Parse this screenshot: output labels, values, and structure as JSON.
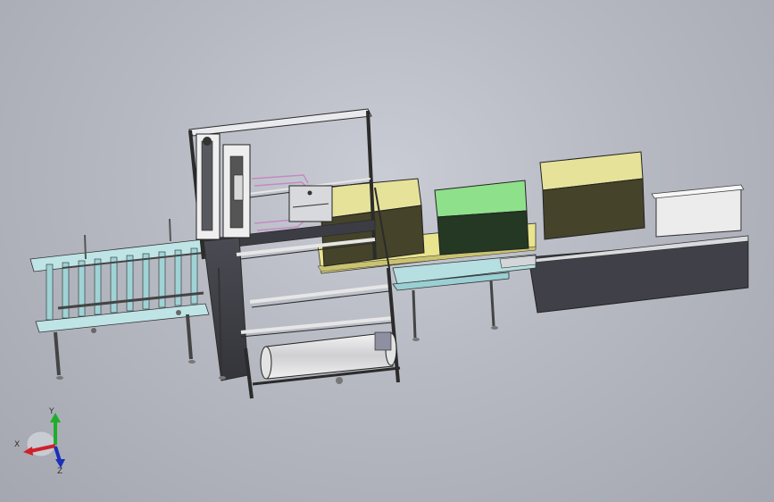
{
  "viewport": {
    "background": "#b8bbc4"
  },
  "triad": {
    "x_label": "X",
    "y_label": "Y",
    "z_label": "Z",
    "x_color": "#d0202a",
    "y_color": "#1fae2a",
    "z_color": "#1b2fb8"
  },
  "model": {
    "frame_color": "#e7e8ec",
    "roller_color": "#a9d9dd",
    "box_yellow": "#e8e59a",
    "box_green": "#8ee08a",
    "box_white": "#eeeeee",
    "dark_body": "#3f4047",
    "packaging_film": "#c688c4"
  }
}
